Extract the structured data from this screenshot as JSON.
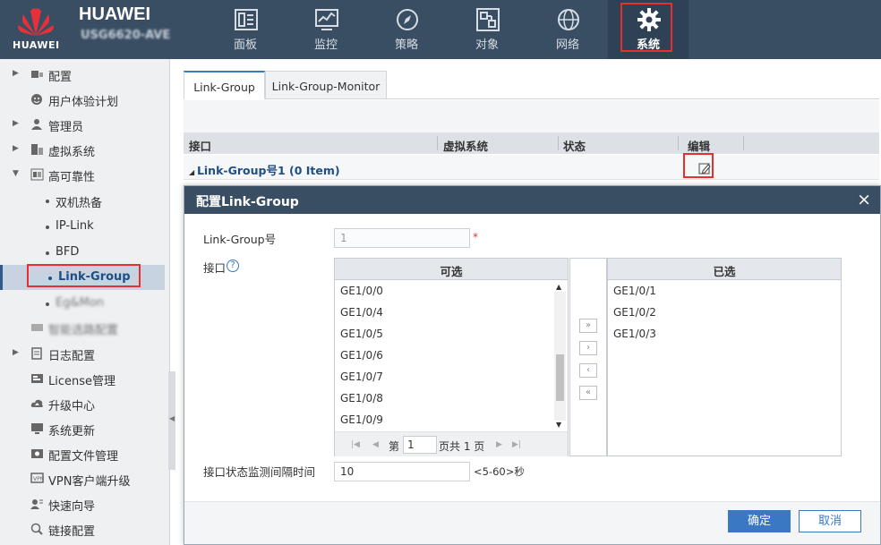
{
  "brand": {
    "logo_text": "HUAWEI",
    "title": "HUAWEI",
    "model": "USG6620-AVE"
  },
  "nav": [
    {
      "label": "面板",
      "icon": "panel-icon"
    },
    {
      "label": "监控",
      "icon": "monitor-icon"
    },
    {
      "label": "策略",
      "icon": "compass-icon"
    },
    {
      "label": "对象",
      "icon": "object-icon"
    },
    {
      "label": "网络",
      "icon": "globe-icon"
    },
    {
      "label": "系统",
      "icon": "gear-icon",
      "active": true
    }
  ],
  "sidebar": {
    "items": [
      {
        "label": "配置",
        "expandable": true
      },
      {
        "label": "用户体验计划"
      },
      {
        "label": "管理员",
        "expandable": true
      },
      {
        "label": "虚拟系统",
        "expandable": true
      },
      {
        "label": "高可靠性",
        "expanded": true
      },
      {
        "label": "双机热备"
      },
      {
        "label": "IP-Link"
      },
      {
        "label": "BFD"
      },
      {
        "label": "Link-Group",
        "selected": true
      },
      {
        "label": "Eg&Mon"
      },
      {
        "label": "智能选路配置"
      },
      {
        "label": "日志配置",
        "expandable": true
      },
      {
        "label": "License管理"
      },
      {
        "label": "升级中心"
      },
      {
        "label": "系统更新"
      },
      {
        "label": "配置文件管理"
      },
      {
        "label": "VPN客户端升级"
      },
      {
        "label": "快速向导"
      },
      {
        "label": "链接配置"
      }
    ]
  },
  "tabs": [
    "Link-Group",
    "Link-Group-Monitor"
  ],
  "table": {
    "headers": [
      "接口",
      "虚拟系统",
      "状态",
      "编辑"
    ],
    "group_row": "Link-Group号1 (0 Item)"
  },
  "dialog": {
    "title": "配置Link-Group",
    "close": "×",
    "group_no_label": "Link-Group号",
    "group_no_value": "1",
    "required_mark": "*",
    "interface_label": "接口",
    "help": "?",
    "available_header": "可选",
    "available": [
      "GE1/0/0",
      "GE1/0/4",
      "GE1/0/5",
      "GE1/0/6",
      "GE1/0/7",
      "GE1/0/8",
      "GE1/0/9"
    ],
    "selected_header": "已选",
    "selected": [
      "GE1/0/1",
      "GE1/0/2",
      "GE1/0/3"
    ],
    "pager": {
      "prefix": "第",
      "page": "1",
      "suffix": "页共 1 页"
    },
    "move_buttons": [
      "»",
      "›",
      "‹",
      "«"
    ],
    "interval_label": "接口状态监测间隔时间",
    "interval_value": "10",
    "interval_range": "<5-60>秒",
    "ok": "确定",
    "cancel": "取消"
  },
  "colors": {
    "header_bg": "#3a4e63",
    "accent": "#3a78c3",
    "highlight": "#e53030"
  }
}
